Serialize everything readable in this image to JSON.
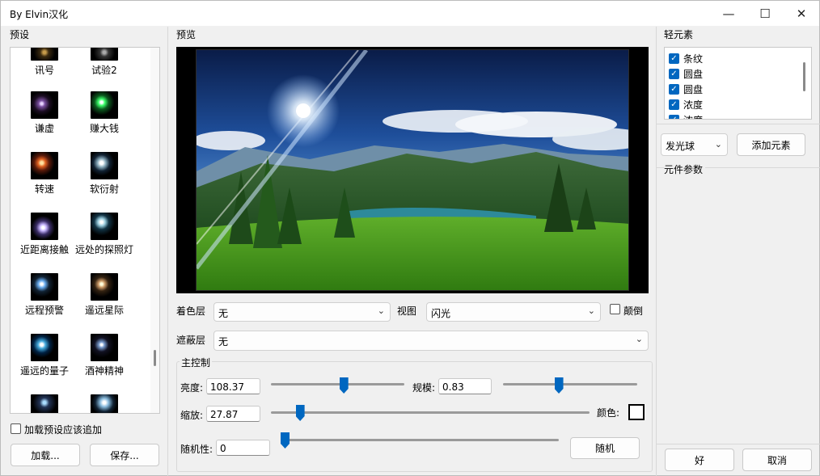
{
  "window": {
    "title": "By Elvin汉化",
    "minimize": "—",
    "maximize": "☐",
    "close": "✕"
  },
  "presets": {
    "label": "预设",
    "items": [
      "讯号",
      "试验2",
      "谦虚",
      "赚大钱",
      "转速",
      "软衍射",
      "近距离接触",
      "远处的探照灯",
      "远程预警",
      "遥远星际",
      "遥远的量子",
      "酒神精神",
      "",
      ""
    ],
    "append_label": "加载预设应该追加",
    "load_button": "加载...",
    "save_button": "保存..."
  },
  "preview": {
    "label": "预览",
    "tint_label": "着色层",
    "tint_value": "无",
    "view_label": "视图",
    "view_value": "闪光",
    "invert_label": "颠倒",
    "mask_label": "遮蔽层",
    "mask_value": "无"
  },
  "main_control": {
    "label": "主控制",
    "brightness_label": "亮度:",
    "brightness_value": "108.37",
    "brightness_level": 0.55,
    "scale_label": "规模:",
    "scale_value": "0.83",
    "scale_level": 0.41,
    "zoom_label": "缩放:",
    "zoom_value": "27.87",
    "zoom_level": 0.08,
    "color_label": "颜色:",
    "color_value": "#ffffff",
    "random_label": "随机性:",
    "random_value": "0",
    "random_level": 0.0,
    "random_button": "随机"
  },
  "light_elements": {
    "label": "轻元素",
    "items": [
      {
        "name": "条纹",
        "checked": true
      },
      {
        "name": "圆盘",
        "checked": true
      },
      {
        "name": "圆盘",
        "checked": true
      },
      {
        "name": "浓度",
        "checked": true
      },
      {
        "name": "浓度",
        "checked": true
      }
    ],
    "type_value": "发光球",
    "add_button": "添加元素",
    "params_label": "元件参数"
  },
  "dialog": {
    "ok": "好",
    "cancel": "取消"
  },
  "colors": {
    "accent": "#0067c0"
  }
}
